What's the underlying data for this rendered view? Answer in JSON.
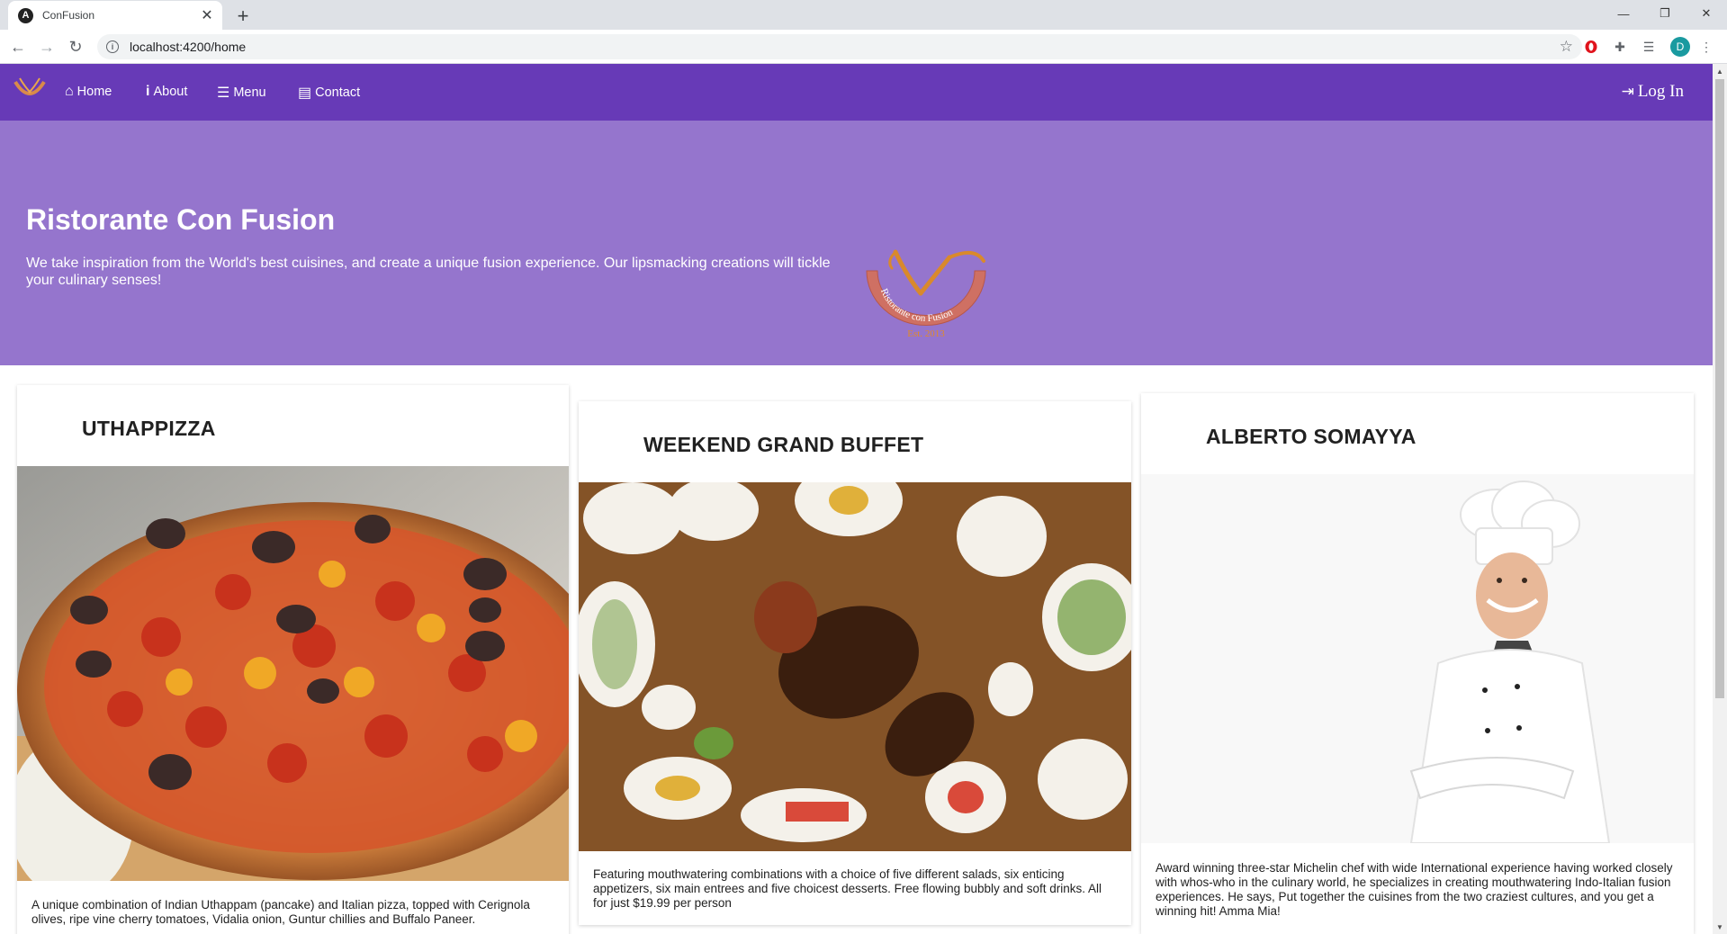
{
  "browser": {
    "tab_title": "ConFusion",
    "tab_favicon": "A",
    "url": "localhost:4200/home",
    "profile_initial": "D"
  },
  "nav": {
    "items": [
      {
        "label": "Home",
        "icon": "home-icon"
      },
      {
        "label": "About",
        "icon": "info-icon"
      },
      {
        "label": "Menu",
        "icon": "list-icon"
      },
      {
        "label": "Contact",
        "icon": "address-card-icon"
      }
    ],
    "login_label": "Log In",
    "color": "#673ab7"
  },
  "jumbotron": {
    "title": "Ristorante Con Fusion",
    "description": "We take inspiration from the World's best cuisines, and create a unique fusion experience. Our lipsmacking creations will tickle your culinary senses!",
    "logo_text": "Ristorante con Fusion",
    "logo_est": "Est. 2013",
    "color": "#9575cd"
  },
  "cards": [
    {
      "title": "UTHAPPIZZA",
      "image": "pizza",
      "description": "A unique combination of Indian Uthappam (pancake) and Italian pizza, topped with Cerignola olives, ripe vine cherry tomatoes, Vidalia onion, Guntur chillies and Buffalo Paneer."
    },
    {
      "title": "WEEKEND GRAND BUFFET",
      "image": "buffet",
      "description": "Featuring mouthwatering combinations with a choice of five different salads, six enticing appetizers, six main entrees and five choicest desserts. Free flowing bubbly and soft drinks. All for just $19.99 per person"
    },
    {
      "title": "ALBERTO SOMAYYA",
      "image": "chef",
      "description": "Award winning three-star Michelin chef with wide International experience having worked closely with whos-who in the culinary world, he specializes in creating mouthwatering Indo-Italian fusion experiences. He says, Put together the cuisines from the two craziest cultures, and you get a winning hit! Amma Mia!"
    }
  ]
}
